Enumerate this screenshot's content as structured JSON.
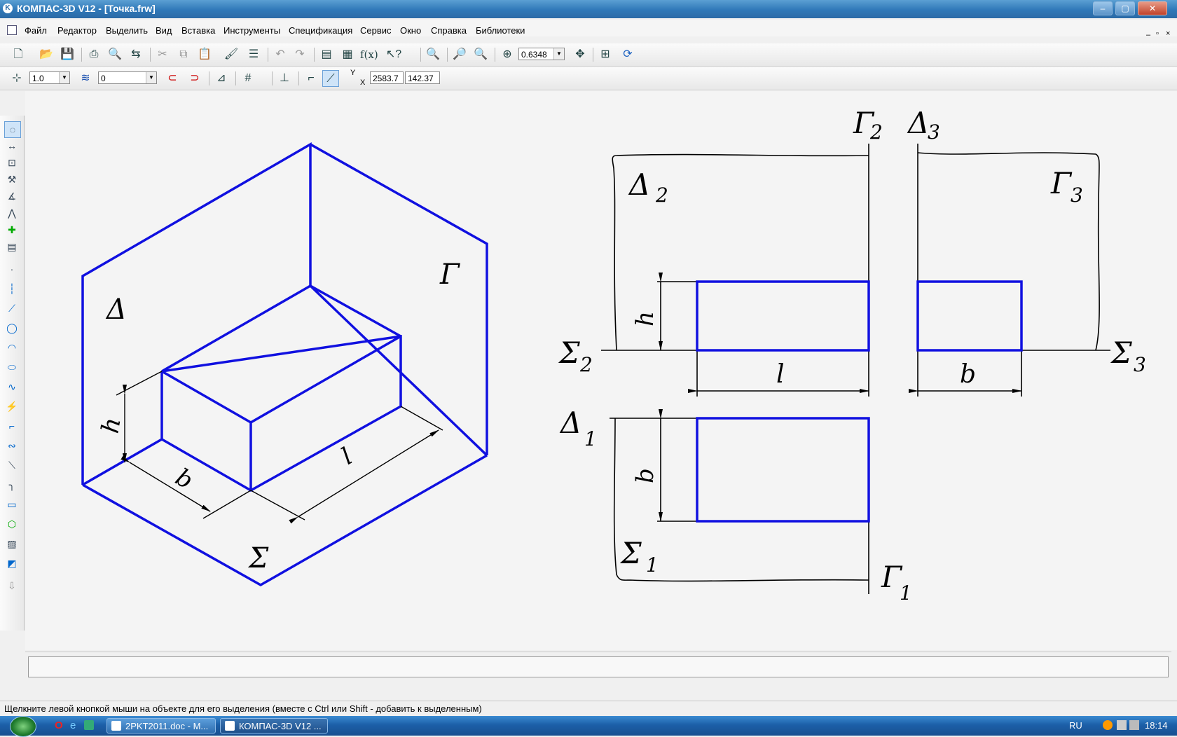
{
  "window": {
    "title": "КОМПАС-3D V12 - [Точка.frw]",
    "min": "–",
    "max": "▢",
    "close": "✕"
  },
  "menu": [
    "Файл",
    "Редактор",
    "Выделить",
    "Вид",
    "Вставка",
    "Инструменты",
    "Спецификация",
    "Сервис",
    "Окно",
    "Справка",
    "Библиотеки"
  ],
  "toolbar2": {
    "step": "1.0",
    "layer": "0",
    "zoom": "0.6348",
    "coord_y": "2583.7",
    "coord_x": "142.37",
    "y_label": "Y",
    "x_label": "X"
  },
  "drawing": {
    "labels": {
      "delta": "Δ",
      "gamma": "Γ",
      "sigma": "Σ",
      "h": "h",
      "b": "b",
      "l": "l",
      "gamma2": "Γ",
      "gamma2_sub": "2",
      "delta3": "Δ",
      "delta3_sub": "3",
      "delta2": "Δ",
      "delta2_sub": "2",
      "gamma3": "Γ",
      "gamma3_sub": "3",
      "sigma2": "Σ",
      "sigma2_sub": "2",
      "sigma3": "Σ",
      "sigma3_sub": "3",
      "delta1": "Δ",
      "delta1_sub": "1",
      "sigma1": "Σ",
      "sigma1_sub": "1",
      "gamma1": "Γ",
      "gamma1_sub": "1"
    },
    "colors": {
      "object": "#1010e0",
      "line": "#000000"
    }
  },
  "status": {
    "hint": "Щелкните левой кнопкой мыши на объекте для его выделения (вместе с Ctrl или Shift - добавить к выделенным)"
  },
  "taskbar": {
    "items": [
      {
        "label": "2PKT2011.doc - M...",
        "active": false
      },
      {
        "label": "КОМПАС-3D V12 ...",
        "active": true
      }
    ],
    "lang": "RU",
    "time": "18:14"
  }
}
